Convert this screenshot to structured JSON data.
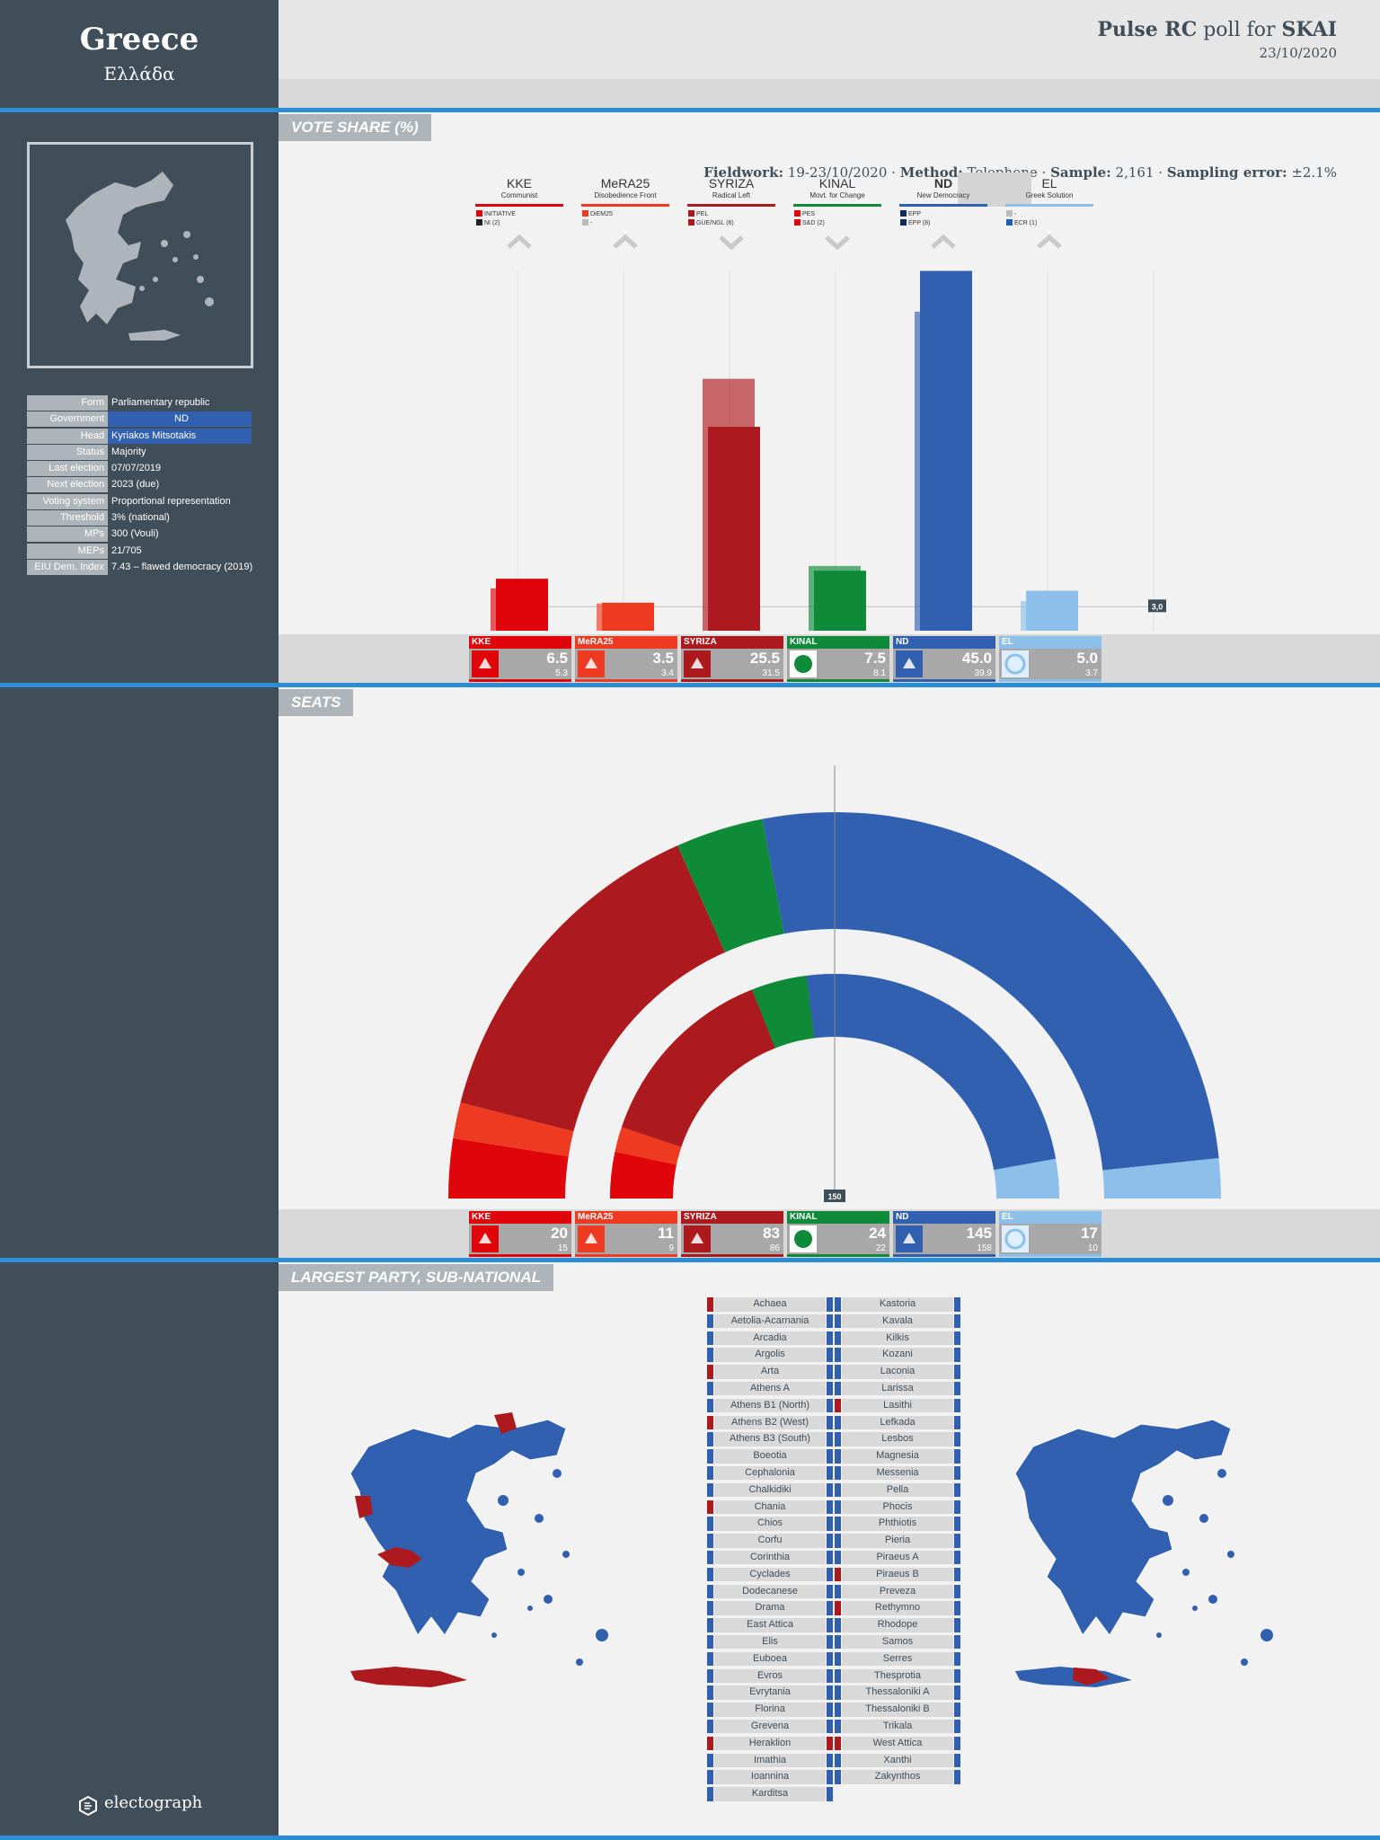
{
  "country": {
    "name": "Greece",
    "native": "Ελλάδα"
  },
  "poll": {
    "pollster": "Pulse RC",
    "connector": "poll for",
    "client": "SKAI",
    "date": "23/10/2020",
    "fieldwork_label": "Fieldwork:",
    "fieldwork": "19-23/10/2020",
    "method_label": "Method:",
    "method": "Telephone",
    "sample_label": "Sample:",
    "sample": "2,161",
    "error_label": "Sampling error:",
    "error": "±2.1%"
  },
  "info": [
    {
      "k": "Form",
      "v": "Parliamentary republic"
    },
    {
      "k": "Government",
      "v": "ND",
      "hl": true
    },
    {
      "k": "Head",
      "v": "Kyriakos Mitsotakis",
      "hl": true
    },
    {
      "k": "Status",
      "v": "Majority"
    },
    {
      "k": "Last election",
      "v": "07/07/2019"
    },
    {
      "k": "Next election",
      "v": "2023 (due)"
    },
    {
      "k": "Voting system",
      "v": "Proportional representation"
    },
    {
      "k": "Threshold",
      "v": "3% (national)"
    },
    {
      "k": "MPs",
      "v": "300 (Vouli)"
    },
    {
      "k": "MEPs",
      "v": "21/705"
    },
    {
      "k": "EIU Dem. Index",
      "v": "7.43 – flawed democracy (2019)"
    }
  ],
  "brand": "electograph",
  "sections": {
    "vote": "VOTE SHARE (%)",
    "seats": "SEATS",
    "regions": "LARGEST PARTY, SUB-NATIONAL"
  },
  "parties": [
    {
      "abbr": "KKE",
      "full": "Communist",
      "color": "#e0040b",
      "g1": "INITIATIVE",
      "c1": "#e0040b",
      "g2": "NI (2)",
      "c2": "#222222",
      "trend": "up"
    },
    {
      "abbr": "MeRA25",
      "full": "Disobedience Front",
      "color": "#ef3a22",
      "g1": "DiEM25",
      "c1": "#ef3a22",
      "g2": "-",
      "c2": "#bbbbbb",
      "trend": "up"
    },
    {
      "abbr": "SYRIZA",
      "full": "Radical Left",
      "color": "#ad1a1d",
      "g1": "PEL",
      "c1": "#ad1a1d",
      "g2": "GUE/NGL (6)",
      "c2": "#ad1a1d",
      "trend": "down"
    },
    {
      "abbr": "KINAL",
      "full": "Movt. for Change",
      "color": "#0e8a38",
      "g1": "PES",
      "c1": "#e0040b",
      "g2": "S&D (2)",
      "c2": "#e0040b",
      "trend": "down"
    },
    {
      "abbr": "ND",
      "full": "New Democracy",
      "color": "#3160b0",
      "g1": "EPP",
      "c1": "#102b5c",
      "g2": "EPP (8)",
      "c2": "#102b5c",
      "trend": "up"
    },
    {
      "abbr": "EL",
      "full": "Greek Solution",
      "color": "#8cc0ea",
      "g1": "-",
      "c1": "#bbbbbb",
      "g2": "ECR (1)",
      "c2": "#1e5fb0",
      "trend": "up"
    }
  ],
  "chart_data": [
    {
      "type": "bar",
      "title": "VOTE SHARE (%)",
      "categories": [
        "KKE",
        "MeRA25",
        "SYRIZA",
        "KINAL",
        "ND",
        "EL"
      ],
      "series": [
        {
          "values": [
            6.5,
            3.5,
            25.5,
            7.5,
            45.0,
            5.0
          ]
        },
        {
          "values": [
            5.3,
            3.4,
            31.5,
            8.1,
            39.9,
            3.7
          ]
        }
      ],
      "threshold": 3.0,
      "threshold_label": "3,0"
    },
    {
      "type": "pie",
      "title": "SEATS",
      "categories": [
        "KKE",
        "MeRA25",
        "SYRIZA",
        "KINAL",
        "ND",
        "EL"
      ],
      "series": [
        {
          "values": [
            20,
            11,
            83,
            24,
            145,
            17
          ]
        },
        {
          "values": [
            15,
            9,
            86,
            22,
            158,
            10
          ]
        }
      ],
      "majority": 150,
      "majority_label": "150",
      "total": 300
    }
  ],
  "regions_left": [
    {
      "name": "Achaea",
      "lc": "#ad1a1d",
      "rc": "#3160b0"
    },
    {
      "name": "Aetolia-Acarnania",
      "lc": "#3160b0",
      "rc": "#3160b0"
    },
    {
      "name": "Arcadia",
      "lc": "#3160b0",
      "rc": "#3160b0"
    },
    {
      "name": "Argolis",
      "lc": "#3160b0",
      "rc": "#3160b0"
    },
    {
      "name": "Arta",
      "lc": "#ad1a1d",
      "rc": "#3160b0"
    },
    {
      "name": "Athens A",
      "lc": "#3160b0",
      "rc": "#3160b0"
    },
    {
      "name": "Athens B1 (North)",
      "lc": "#3160b0",
      "rc": "#3160b0"
    },
    {
      "name": "Athens B2 (West)",
      "lc": "#ad1a1d",
      "rc": "#3160b0"
    },
    {
      "name": "Athens B3 (South)",
      "lc": "#3160b0",
      "rc": "#3160b0"
    },
    {
      "name": "Boeotia",
      "lc": "#3160b0",
      "rc": "#3160b0"
    },
    {
      "name": "Cephalonia",
      "lc": "#3160b0",
      "rc": "#3160b0"
    },
    {
      "name": "Chalkidiki",
      "lc": "#3160b0",
      "rc": "#3160b0"
    },
    {
      "name": "Chania",
      "lc": "#ad1a1d",
      "rc": "#3160b0"
    },
    {
      "name": "Chios",
      "lc": "#3160b0",
      "rc": "#3160b0"
    },
    {
      "name": "Corfu",
      "lc": "#3160b0",
      "rc": "#3160b0"
    },
    {
      "name": "Corinthia",
      "lc": "#3160b0",
      "rc": "#3160b0"
    },
    {
      "name": "Cyclades",
      "lc": "#3160b0",
      "rc": "#3160b0"
    },
    {
      "name": "Dodecanese",
      "lc": "#3160b0",
      "rc": "#3160b0"
    },
    {
      "name": "Drama",
      "lc": "#3160b0",
      "rc": "#3160b0"
    },
    {
      "name": "East Attica",
      "lc": "#3160b0",
      "rc": "#3160b0"
    },
    {
      "name": "Elis",
      "lc": "#3160b0",
      "rc": "#3160b0"
    },
    {
      "name": "Euboea",
      "lc": "#3160b0",
      "rc": "#3160b0"
    },
    {
      "name": "Evros",
      "lc": "#3160b0",
      "rc": "#3160b0"
    },
    {
      "name": "Evrytania",
      "lc": "#3160b0",
      "rc": "#3160b0"
    },
    {
      "name": "Florina",
      "lc": "#3160b0",
      "rc": "#3160b0"
    },
    {
      "name": "Grevena",
      "lc": "#3160b0",
      "rc": "#3160b0"
    },
    {
      "name": "Heraklion",
      "lc": "#ad1a1d",
      "rc": "#ad1a1d"
    },
    {
      "name": "Imathia",
      "lc": "#3160b0",
      "rc": "#3160b0"
    },
    {
      "name": "Ioannina",
      "lc": "#3160b0",
      "rc": "#3160b0"
    },
    {
      "name": "Karditsa",
      "lc": "#3160b0",
      "rc": "#3160b0"
    }
  ],
  "regions_right": [
    {
      "name": "Kastoria",
      "lc": "#3160b0",
      "rc": "#3160b0"
    },
    {
      "name": "Kavala",
      "lc": "#3160b0",
      "rc": "#3160b0"
    },
    {
      "name": "Kilkis",
      "lc": "#3160b0",
      "rc": "#3160b0"
    },
    {
      "name": "Kozani",
      "lc": "#3160b0",
      "rc": "#3160b0"
    },
    {
      "name": "Laconia",
      "lc": "#3160b0",
      "rc": "#3160b0"
    },
    {
      "name": "Larissa",
      "lc": "#3160b0",
      "rc": "#3160b0"
    },
    {
      "name": "Lasithi",
      "lc": "#ad1a1d",
      "rc": "#3160b0"
    },
    {
      "name": "Lefkada",
      "lc": "#3160b0",
      "rc": "#3160b0"
    },
    {
      "name": "Lesbos",
      "lc": "#3160b0",
      "rc": "#3160b0"
    },
    {
      "name": "Magnesia",
      "lc": "#3160b0",
      "rc": "#3160b0"
    },
    {
      "name": "Messenia",
      "lc": "#3160b0",
      "rc": "#3160b0"
    },
    {
      "name": "Pella",
      "lc": "#3160b0",
      "rc": "#3160b0"
    },
    {
      "name": "Phocis",
      "lc": "#3160b0",
      "rc": "#3160b0"
    },
    {
      "name": "Phthiotis",
      "lc": "#3160b0",
      "rc": "#3160b0"
    },
    {
      "name": "Pieria",
      "lc": "#3160b0",
      "rc": "#3160b0"
    },
    {
      "name": "Piraeus A",
      "lc": "#3160b0",
      "rc": "#3160b0"
    },
    {
      "name": "Piraeus B",
      "lc": "#ad1a1d",
      "rc": "#3160b0"
    },
    {
      "name": "Preveza",
      "lc": "#3160b0",
      "rc": "#3160b0"
    },
    {
      "name": "Rethymno",
      "lc": "#ad1a1d",
      "rc": "#3160b0"
    },
    {
      "name": "Rhodope",
      "lc": "#3160b0",
      "rc": "#3160b0"
    },
    {
      "name": "Samos",
      "lc": "#3160b0",
      "rc": "#3160b0"
    },
    {
      "name": "Serres",
      "lc": "#3160b0",
      "rc": "#3160b0"
    },
    {
      "name": "Thesprotia",
      "lc": "#3160b0",
      "rc": "#3160b0"
    },
    {
      "name": "Thessaloniki A",
      "lc": "#3160b0",
      "rc": "#3160b0"
    },
    {
      "name": "Thessaloniki B",
      "lc": "#3160b0",
      "rc": "#3160b0"
    },
    {
      "name": "Trikala",
      "lc": "#3160b0",
      "rc": "#3160b0"
    },
    {
      "name": "West Attica",
      "lc": "#ad1a1d",
      "rc": "#3160b0"
    },
    {
      "name": "Xanthi",
      "lc": "#3160b0",
      "rc": "#3160b0"
    },
    {
      "name": "Zakynthos",
      "lc": "#3160b0",
      "rc": "#3160b0"
    }
  ]
}
